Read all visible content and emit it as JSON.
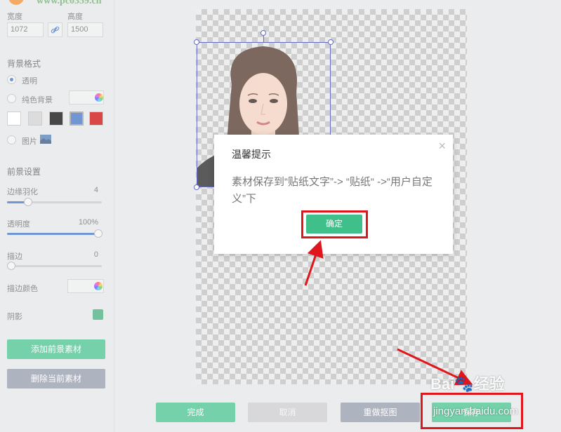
{
  "logo": {
    "text": "www.pc0359.cn"
  },
  "size": {
    "width_label": "宽度",
    "height_label": "高度",
    "width_value": "1072",
    "height_value": "1500"
  },
  "background": {
    "section": "背景格式",
    "opt_transparent": "透明",
    "opt_solid": "纯色背景",
    "opt_image": "图片",
    "swatches": [
      "#ffffff",
      "#cfcfcf",
      "#000000",
      "#3a6fc4",
      "#cc0000"
    ]
  },
  "foreground": {
    "section": "前景设置",
    "feather_label": "边缘羽化",
    "feather_value": "4",
    "opacity_label": "透明度",
    "opacity_value": "100%",
    "stroke_label": "描边",
    "stroke_value": "0",
    "stroke_color_label": "描边颜色",
    "shadow_label": "阴影"
  },
  "buttons": {
    "add": "添加前景素材",
    "delete": "删除当前素材"
  },
  "bottom": {
    "finish": "完成",
    "cancel": "取消",
    "redo": "重做抠图",
    "save": "保存"
  },
  "dialog": {
    "title": "温馨提示",
    "message": "素材保存到“贴纸文字”-> “贴纸“ ->“用户自定义”下",
    "ok": "确定"
  },
  "watermark": {
    "main": "Bai🐾经验",
    "sub": "jingyan.baidu.com"
  },
  "colors": {
    "accent_green": "#3fbf8a",
    "accent_blue": "#3a6fc4",
    "annotation_red": "#e0161c"
  }
}
